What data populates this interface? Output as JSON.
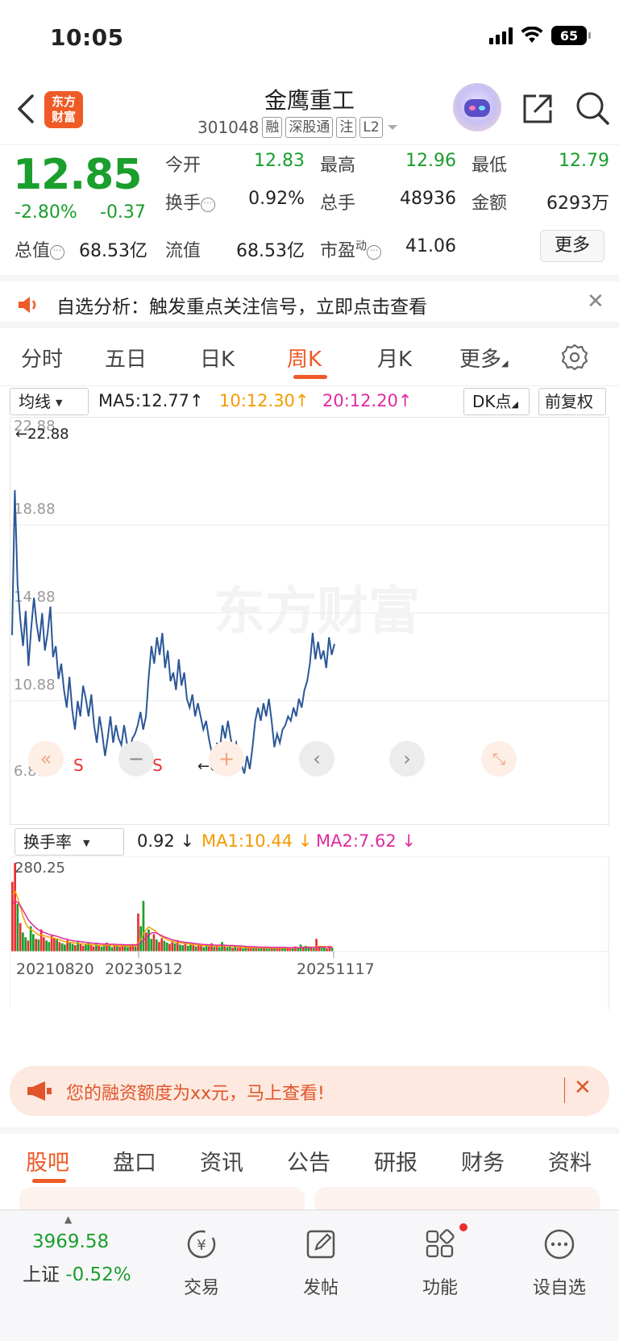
{
  "status_bar": {
    "time": "10:05",
    "battery": "65"
  },
  "header": {
    "logo_line1": "东方",
    "logo_line2": "财富",
    "stock_name": "金鹰重工",
    "stock_code": "301048",
    "tags": [
      "融",
      "深股通",
      "注",
      "L2"
    ]
  },
  "quote": {
    "price": "12.85",
    "change_pct": "-2.80%",
    "change_abs": "-0.37",
    "open_label": "今开",
    "open": "12.83",
    "high_label": "最高",
    "high": "12.96",
    "low_label": "最低",
    "low": "12.79",
    "turnover_label": "换手",
    "turnover": "0.92%",
    "volume_label": "总手",
    "volume": "48936",
    "amount_label": "金额",
    "amount": "6293万",
    "total_mv_label": "总值",
    "total_mv": "68.53亿",
    "float_mv_label": "流值",
    "float_mv": "68.53亿",
    "pe_label": "市盈",
    "pe_sup": "动",
    "pe": "41.06",
    "more": "更多"
  },
  "notice": {
    "text": "自选分析：触发重点关注信号，立即点击查看"
  },
  "period_tabs": [
    "分时",
    "五日",
    "日K",
    "周K",
    "月K",
    "更多"
  ],
  "ma_row": {
    "dropdown": "均线",
    "ma5": "MA5:12.77",
    "ma10": "10:12.30",
    "ma20": "20:12.20",
    "dk": "DK点",
    "adjust": "前复权"
  },
  "chart_data": [
    {
      "type": "line",
      "title": "",
      "ylim": [
        6.88,
        22.88
      ],
      "yticks": [
        "22.88",
        "18.88",
        "14.88",
        "10.88",
        "6.88"
      ],
      "annotations": [
        "22.88",
        "6.88",
        "S",
        "S",
        "S",
        "S"
      ],
      "x": [
        "20210820",
        "20230512",
        "20251117"
      ],
      "series": [
        {
          "values": [
            13.5,
            20.1,
            15.8,
            14.2,
            13.0,
            14.6,
            12.1,
            13.8,
            15.2,
            14.0,
            13.2,
            14.5,
            12.8,
            13.6,
            14.8,
            12.5,
            13.0,
            11.5,
            12.2,
            11.0,
            10.2,
            11.6,
            10.1,
            9.2,
            10.5,
            9.8,
            11.2,
            10.6,
            9.8,
            10.8,
            9.4,
            8.6,
            9.8,
            9.0,
            8.0,
            8.8,
            9.8,
            8.6,
            9.4,
            8.8,
            8.5,
            9.4,
            8.6,
            8.2,
            8.8,
            9.0,
            9.4,
            10.0,
            9.2,
            9.8,
            11.6,
            13.0,
            12.2,
            13.4,
            12.6,
            13.6,
            12.0,
            12.8,
            11.4,
            11.8,
            11.0,
            12.4,
            11.2,
            11.8,
            10.6,
            10.2,
            10.8,
            9.8,
            10.4,
            9.8,
            9.2,
            9.6,
            8.8,
            8.2,
            7.6,
            8.6,
            8.2,
            9.4,
            8.8,
            9.6,
            8.8,
            8.2,
            8.6,
            8.0,
            7.6,
            7.2,
            8.0,
            7.4,
            8.4,
            9.6,
            10.2,
            9.6,
            10.4,
            9.8,
            10.6,
            9.6,
            8.4,
            9.0,
            8.6,
            9.2,
            9.4,
            9.8,
            9.6,
            10.2,
            9.8,
            10.6,
            10.2,
            11.0,
            11.4,
            12.2,
            13.6,
            12.4,
            13.2,
            12.4,
            12.8,
            12.0,
            13.4,
            12.6,
            13.1
          ]
        }
      ]
    },
    {
      "type": "bar",
      "title": "",
      "ylim": [
        0,
        280.25
      ],
      "yticks": [
        "280.25"
      ],
      "x": [
        "20210820",
        "20230512",
        "20251117"
      ],
      "series": [
        {
          "name": "换手率",
          "values": [
            220,
            280,
            150,
            90,
            60,
            45,
            35,
            80,
            55,
            40,
            38,
            70,
            45,
            35,
            30,
            50,
            42,
            38,
            30,
            26,
            22,
            36,
            28,
            24,
            20,
            32,
            25,
            18,
            22,
            28,
            20,
            16,
            24,
            18,
            15,
            22,
            28,
            18,
            14,
            20,
            18,
            15,
            22,
            16,
            14,
            18,
            24,
            16,
            120,
            80,
            160,
            60,
            70,
            40,
            55,
            38,
            30,
            42,
            34,
            28,
            24,
            30,
            26,
            36,
            22,
            20,
            28,
            18,
            24,
            20,
            16,
            22,
            18,
            14,
            20,
            16,
            26,
            15,
            18,
            14,
            30,
            16,
            14,
            18,
            12,
            16,
            12,
            14,
            10,
            12,
            14,
            10,
            15,
            12,
            10,
            14,
            12,
            10,
            12,
            14,
            11,
            9,
            12,
            10,
            13,
            11,
            9,
            12,
            16,
            10,
            22,
            14,
            18,
            12,
            14,
            10,
            40,
            14,
            12,
            16,
            10,
            18,
            12
          ]
        },
        {
          "name": "MA1",
          "values": [
            180,
            190,
            170,
            140,
            110,
            90,
            75,
            70,
            65,
            58,
            52,
            52,
            50,
            48,
            45,
            44,
            42,
            40,
            37,
            34,
            31,
            30,
            29,
            28,
            26,
            26,
            25,
            24,
            23,
            23,
            22,
            21,
            21,
            20,
            19,
            19,
            20,
            20,
            19,
            19,
            18,
            18,
            18,
            17,
            17,
            17,
            18,
            18,
            28,
            40,
            58,
            70,
            78,
            72,
            68,
            60,
            52,
            46,
            42,
            38,
            34,
            32,
            30,
            29,
            28,
            26,
            25,
            24,
            23,
            22,
            21,
            20,
            19,
            19,
            18,
            18,
            18,
            18,
            17,
            17,
            18,
            18,
            17,
            17,
            16,
            16,
            15,
            14,
            13,
            13,
            12,
            12,
            12,
            12,
            12,
            12,
            12,
            11,
            11,
            11,
            11,
            11,
            11,
            11,
            11,
            11,
            11,
            11,
            11,
            12,
            13,
            14,
            14,
            14,
            14,
            14,
            16,
            16,
            16,
            16,
            15,
            15,
            15
          ]
        },
        {
          "name": "MA2",
          "values": [
            150,
            160,
            155,
            145,
            130,
            115,
            100,
            90,
            82,
            74,
            68,
            64,
            60,
            57,
            54,
            52,
            50,
            48,
            45,
            42,
            40,
            38,
            36,
            34,
            33,
            32,
            31,
            30,
            29,
            28,
            27,
            26,
            26,
            25,
            24,
            24,
            24,
            23,
            23,
            23,
            22,
            22,
            22,
            21,
            21,
            21,
            21,
            21,
            24,
            28,
            36,
            44,
            52,
            58,
            60,
            58,
            54,
            50,
            46,
            43,
            40,
            37,
            35,
            33,
            31,
            30,
            29,
            28,
            27,
            26,
            25,
            24,
            23,
            22,
            22,
            21,
            21,
            20,
            20,
            20,
            20,
            20,
            19,
            19,
            19,
            18,
            18,
            17,
            17,
            16,
            16,
            15,
            15,
            15,
            14,
            14,
            14,
            14,
            13,
            13,
            13,
            13,
            13,
            13,
            13,
            12,
            12,
            12,
            12,
            12,
            12,
            13,
            13,
            13,
            13,
            13,
            13,
            14,
            14,
            14,
            14,
            14,
            14
          ]
        }
      ]
    }
  ],
  "vol_row": {
    "dropdown": "换手率",
    "value": "0.92",
    "ma1": "MA1:10.44",
    "ma2": "MA2:7.62"
  },
  "watermark": "东方财富",
  "ad": {
    "text": "您的融资额度为xx元，马上查看!"
  },
  "info_tabs": [
    "股吧",
    "盘口",
    "资讯",
    "公告",
    "研报",
    "财务",
    "资料"
  ],
  "bottom_nav": {
    "index_value": "3969.58",
    "index_name": "上证",
    "index_change": "-0.52%",
    "trade": "交易",
    "post": "发帖",
    "function": "功能",
    "add_watch": "设自选"
  },
  "colors": {
    "accent": "#ef5a26",
    "down": "#1a9e2c",
    "up": "#e93030",
    "ma10": "#f59a00",
    "ma20": "#e02aa0",
    "line": "#2b5797"
  }
}
